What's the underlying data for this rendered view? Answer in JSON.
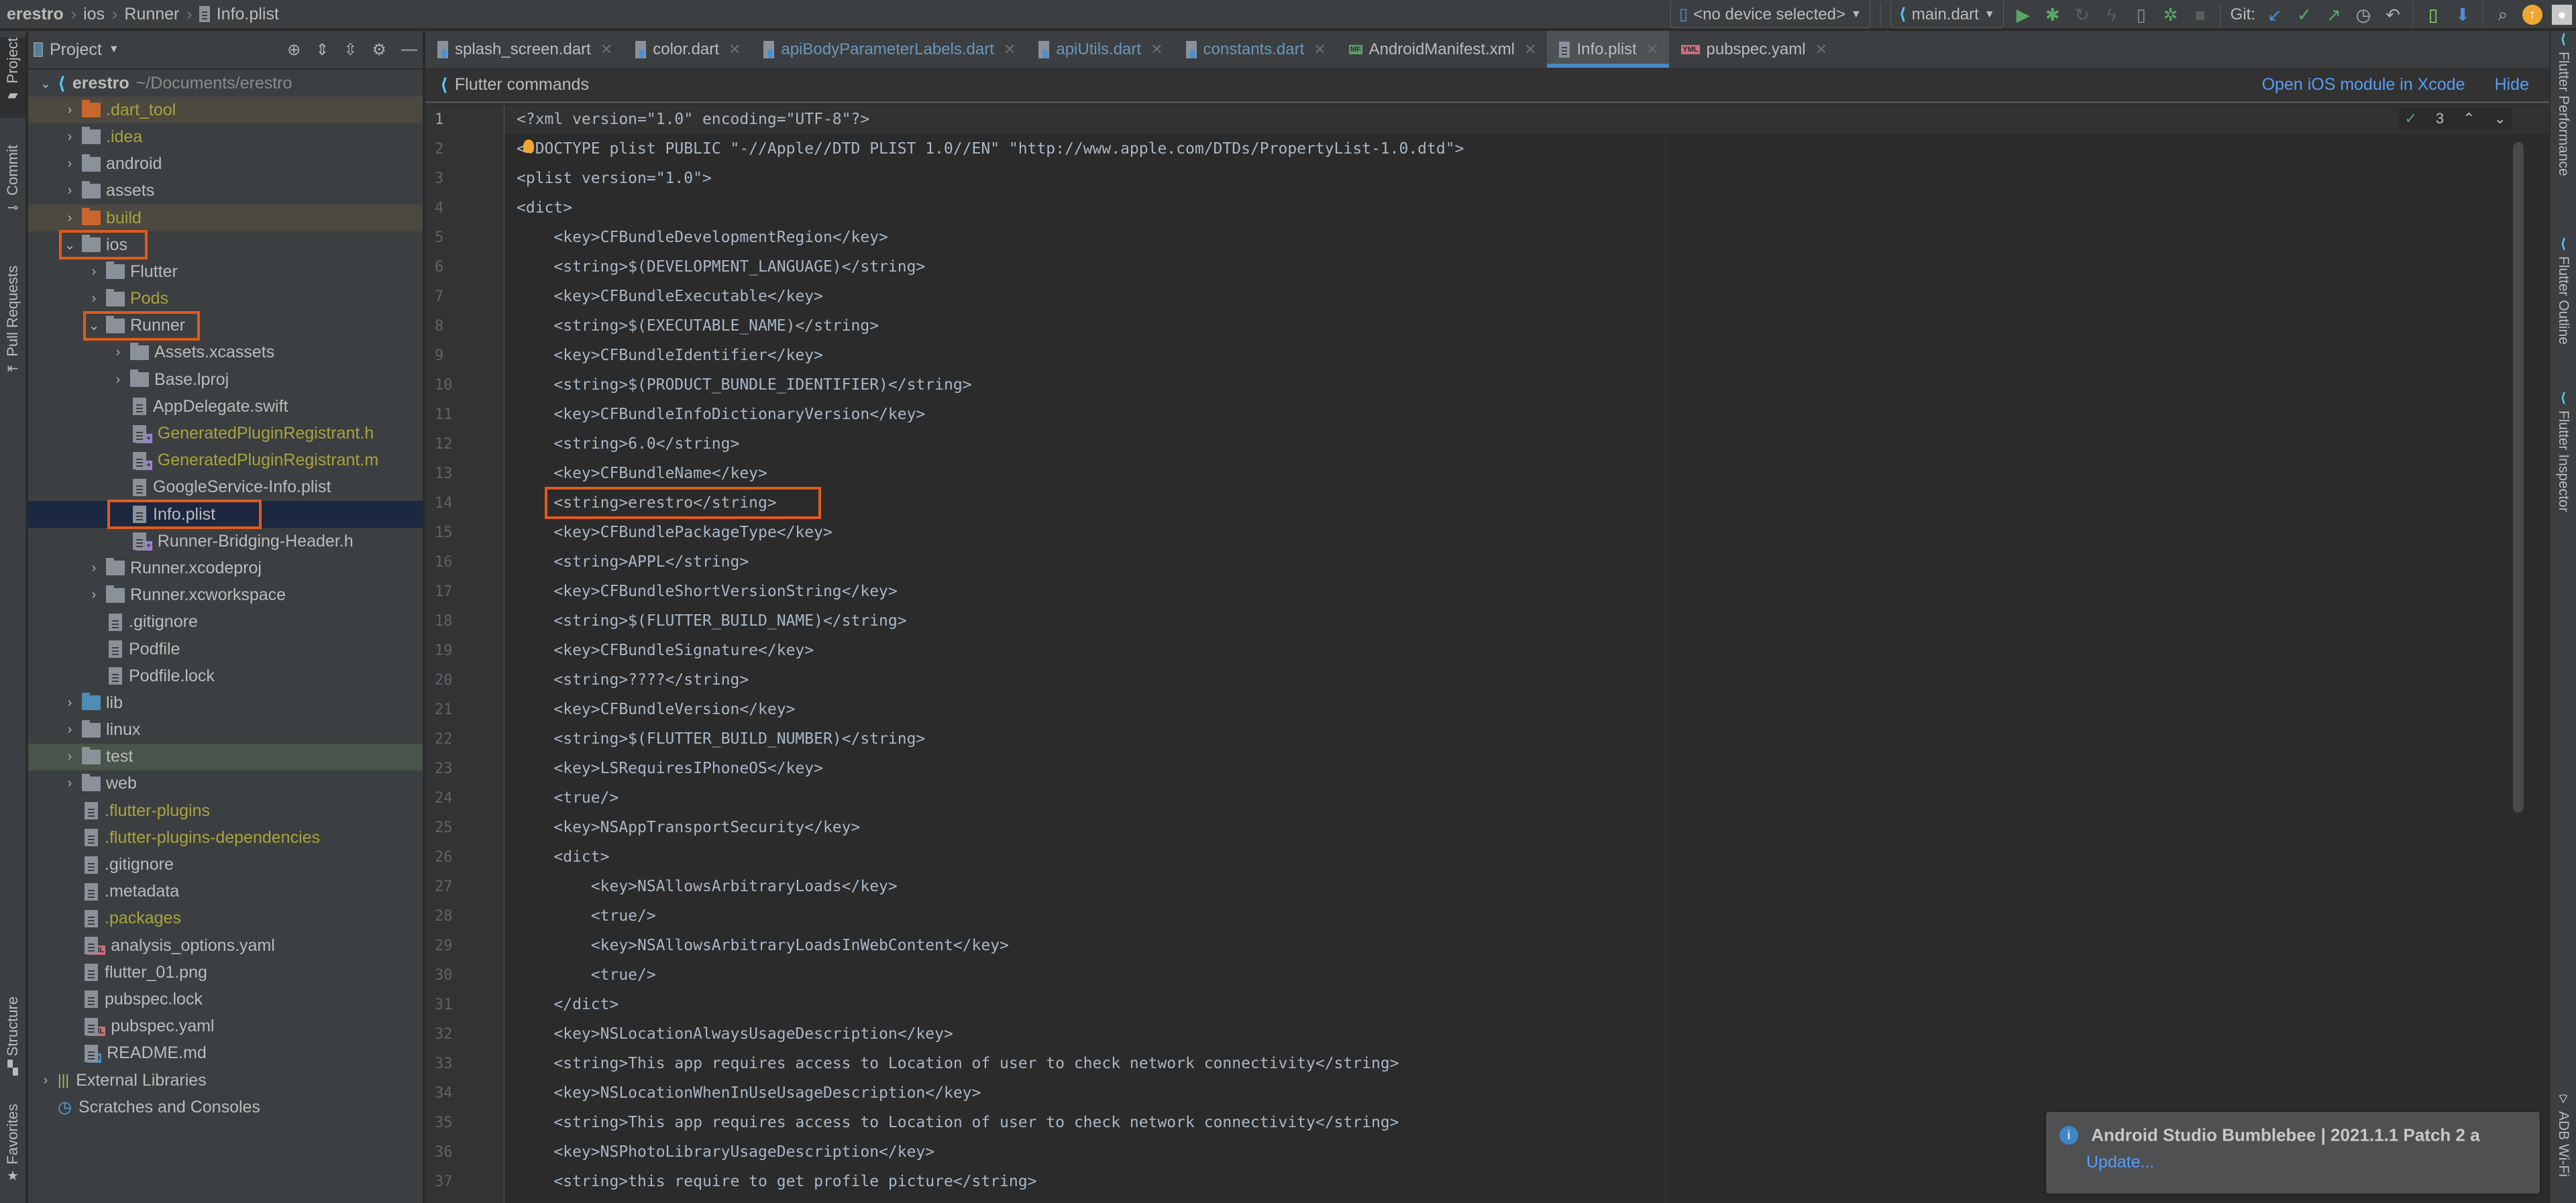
{
  "breadcrumb": [
    "erestro",
    "ios",
    "Runner",
    "Info.plist"
  ],
  "toolbar": {
    "device_selector": "<no device selected>",
    "run_config": "main.dart",
    "git_label": "Git:",
    "icons": [
      "run-icon",
      "debug-icon",
      "attach-debugger-icon",
      "hot-reload-icon",
      "device-manager-icon",
      "profile-icon",
      "stop-icon",
      "git-update-icon",
      "git-commit-icon",
      "git-push-icon",
      "git-history-icon",
      "git-rollback-icon",
      "avd-manager-icon",
      "sdk-manager-icon",
      "search-icon",
      "update-icon",
      "avatar"
    ]
  },
  "left_strip": {
    "top": [
      "Project",
      "Commit",
      "Pull Requests"
    ],
    "bottom": [
      "Structure",
      "Favorites"
    ]
  },
  "right_strip": [
    "Flutter Performance",
    "Flutter Outline",
    "Flutter Inspector",
    "ADB Wi-Fi"
  ],
  "project_panel": {
    "title": "Project",
    "root": {
      "name": "erestro",
      "path": "~/Documents/erestro"
    },
    "items": [
      {
        "name": ".dart_tool",
        "type": "folder",
        "depth": 1,
        "state": "collapsed",
        "style": "ignored"
      },
      {
        "name": ".idea",
        "type": "folder",
        "depth": 1,
        "state": "collapsed",
        "style": "yellow"
      },
      {
        "name": "android",
        "type": "folder",
        "depth": 1,
        "state": "collapsed"
      },
      {
        "name": "assets",
        "type": "folder",
        "depth": 1,
        "state": "collapsed"
      },
      {
        "name": "build",
        "type": "folder",
        "depth": 1,
        "state": "collapsed",
        "style": "ignored"
      },
      {
        "name": "ios",
        "type": "folder",
        "depth": 1,
        "state": "expanded",
        "highlighted": true
      },
      {
        "name": "Flutter",
        "type": "folder",
        "depth": 2,
        "state": "collapsed"
      },
      {
        "name": "Pods",
        "type": "folder",
        "depth": 2,
        "state": "collapsed",
        "style": "yellow"
      },
      {
        "name": "Runner",
        "type": "folder",
        "depth": 2,
        "state": "expanded",
        "highlighted": true
      },
      {
        "name": "Assets.xcassets",
        "type": "folder",
        "depth": 3,
        "state": "collapsed"
      },
      {
        "name": "Base.lproj",
        "type": "folder",
        "depth": 3,
        "state": "collapsed"
      },
      {
        "name": "AppDelegate.swift",
        "type": "file",
        "depth": 3
      },
      {
        "name": "GeneratedPluginRegistrant.h",
        "type": "cpp",
        "depth": 3,
        "style": "yellow"
      },
      {
        "name": "GeneratedPluginRegistrant.m",
        "type": "cpp",
        "depth": 3,
        "style": "yellow"
      },
      {
        "name": "GoogleService-Info.plist",
        "type": "file",
        "depth": 3
      },
      {
        "name": "Info.plist",
        "type": "file",
        "depth": 3,
        "selected": true,
        "highlighted": true
      },
      {
        "name": "Runner-Bridging-Header.h",
        "type": "cpp",
        "depth": 3
      },
      {
        "name": "Runner.xcodeproj",
        "type": "folder",
        "depth": 2,
        "state": "collapsed"
      },
      {
        "name": "Runner.xcworkspace",
        "type": "folder",
        "depth": 2,
        "state": "collapsed"
      },
      {
        "name": ".gitignore",
        "type": "file",
        "depth": 2
      },
      {
        "name": "Podfile",
        "type": "file",
        "depth": 2
      },
      {
        "name": "Podfile.lock",
        "type": "file",
        "depth": 2
      },
      {
        "name": "lib",
        "type": "folder-blue",
        "depth": 1,
        "state": "collapsed"
      },
      {
        "name": "linux",
        "type": "folder",
        "depth": 1,
        "state": "collapsed"
      },
      {
        "name": "test",
        "type": "folder",
        "depth": 1,
        "state": "collapsed",
        "style": "test"
      },
      {
        "name": "web",
        "type": "folder",
        "depth": 1,
        "state": "collapsed"
      },
      {
        "name": ".flutter-plugins",
        "type": "file",
        "depth": 1,
        "style": "yellow"
      },
      {
        "name": ".flutter-plugins-dependencies",
        "type": "file",
        "depth": 1,
        "style": "yellow"
      },
      {
        "name": ".gitignore",
        "type": "file",
        "depth": 1
      },
      {
        "name": ".metadata",
        "type": "file",
        "depth": 1
      },
      {
        "name": ".packages",
        "type": "file",
        "depth": 1,
        "style": "yellow"
      },
      {
        "name": "analysis_options.yaml",
        "type": "yml",
        "depth": 1
      },
      {
        "name": "flutter_01.png",
        "type": "img",
        "depth": 1
      },
      {
        "name": "pubspec.lock",
        "type": "file",
        "depth": 1
      },
      {
        "name": "pubspec.yaml",
        "type": "yml",
        "depth": 1
      },
      {
        "name": "README.md",
        "type": "md",
        "depth": 1
      },
      {
        "name": "External Libraries",
        "type": "extlib",
        "depth": 0,
        "state": "collapsed"
      },
      {
        "name": "Scratches and Consoles",
        "type": "scratch",
        "depth": 0
      }
    ]
  },
  "editor_tabs": [
    {
      "label": "splash_screen.dart",
      "icon": "dart",
      "modified": false
    },
    {
      "label": "color.dart",
      "icon": "dart",
      "modified": false
    },
    {
      "label": "apiBodyParameterLabels.dart",
      "icon": "dart",
      "modified": true
    },
    {
      "label": "apiUtils.dart",
      "icon": "dart",
      "modified": true
    },
    {
      "label": "constants.dart",
      "icon": "dart",
      "modified": true
    },
    {
      "label": "AndroidManifest.xml",
      "icon": "mf",
      "modified": false
    },
    {
      "label": "Info.plist",
      "icon": "file",
      "modified": false,
      "active": true
    },
    {
      "label": "pubspec.yaml",
      "icon": "yml",
      "modified": false
    }
  ],
  "flutter_bar": {
    "title": "Flutter commands",
    "open_ios_link": "Open iOS module in Xcode",
    "hide_link": "Hide"
  },
  "inspection": {
    "count": "3"
  },
  "code_lines": [
    "<?xml version=\"1.0\" encoding=\"UTF-8\"?>",
    "<!DOCTYPE plist PUBLIC \"-//Apple//DTD PLIST 1.0//EN\" \"http://www.apple.com/DTDs/PropertyList-1.0.dtd\">",
    "<plist version=\"1.0\">",
    "<dict>",
    "    <key>CFBundleDevelopmentRegion</key>",
    "    <string>$(DEVELOPMENT_LANGUAGE)</string>",
    "    <key>CFBundleExecutable</key>",
    "    <string>$(EXECUTABLE_NAME)</string>",
    "    <key>CFBundleIdentifier</key>",
    "    <string>$(PRODUCT_BUNDLE_IDENTIFIER)</string>",
    "    <key>CFBundleInfoDictionaryVersion</key>",
    "    <string>6.0</string>",
    "    <key>CFBundleName</key>",
    "    <string>erestro</string>",
    "    <key>CFBundlePackageType</key>",
    "    <string>APPL</string>",
    "    <key>CFBundleShortVersionString</key>",
    "    <string>$(FLUTTER_BUILD_NAME)</string>",
    "    <key>CFBundleSignature</key>",
    "    <string>????</string>",
    "    <key>CFBundleVersion</key>",
    "    <string>$(FLUTTER_BUILD_NUMBER)</string>",
    "    <key>LSRequiresIPhoneOS</key>",
    "    <true/>",
    "    <key>NSAppTransportSecurity</key>",
    "    <dict>",
    "        <key>NSAllowsArbitraryLoads</key>",
    "        <true/>",
    "        <key>NSAllowsArbitraryLoadsInWebContent</key>",
    "        <true/>",
    "    </dict>",
    "    <key>NSLocationAlwaysUsageDescription</key>",
    "    <string>This app requires access to Location of user to check network connectivity</string>",
    "    <key>NSLocationWhenInUseUsageDescription</key>",
    "    <string>This app requires access to Location of user to check network connectivity</string>",
    "    <key>NSPhotoLibraryUsageDescription</key>",
    "    <string>this require to get profile picture</string>"
  ],
  "highlighted_code_line": 14,
  "notification": {
    "title": "Android Studio Bumblebee | 2021.1.1 Patch 2 a",
    "action": "Update..."
  },
  "colors": {
    "highlight_box": "#e05a1f",
    "accent": "#4a88c7",
    "link": "#589df6",
    "ignored_text": "#a8a43c"
  }
}
